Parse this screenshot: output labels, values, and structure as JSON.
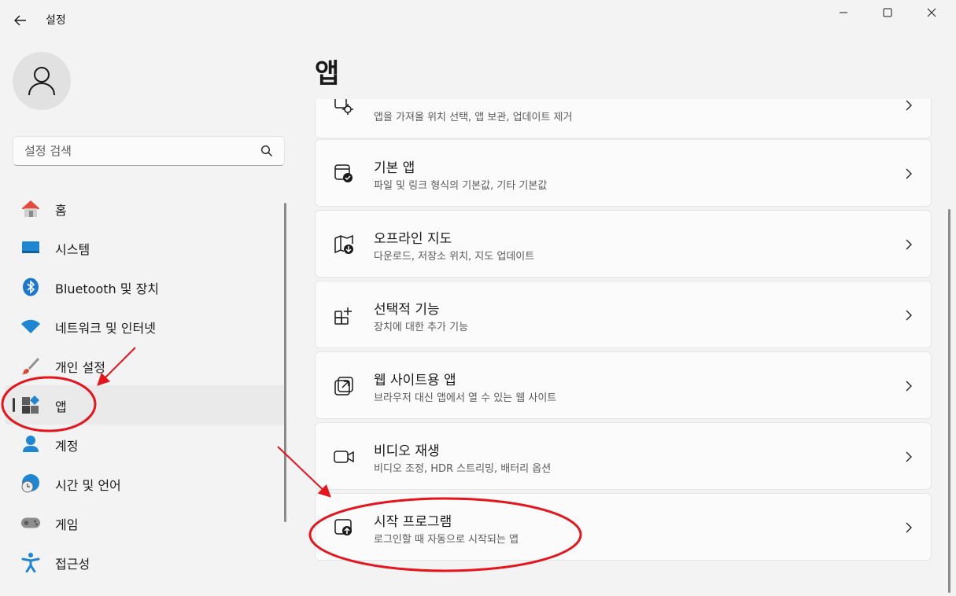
{
  "window": {
    "title": "설정",
    "controls": [
      "minimize-icon",
      "maximize-icon",
      "close-icon"
    ]
  },
  "search": {
    "placeholder": "설정 검색",
    "value": ""
  },
  "sidebar": {
    "items": [
      {
        "label": "홈",
        "icon": "home-icon",
        "selected": false
      },
      {
        "label": "시스템",
        "icon": "system-icon",
        "selected": false
      },
      {
        "label": "Bluetooth 및 장치",
        "icon": "bluetooth-icon",
        "selected": false
      },
      {
        "label": "네트워크 및 인터넷",
        "icon": "wifi-icon",
        "selected": false
      },
      {
        "label": "개인 설정",
        "icon": "brush-icon",
        "selected": false
      },
      {
        "label": "앱",
        "icon": "apps-icon",
        "selected": true
      },
      {
        "label": "계정",
        "icon": "account-icon",
        "selected": false
      },
      {
        "label": "시간 및 언어",
        "icon": "globe-clock-icon",
        "selected": false
      },
      {
        "label": "게임",
        "icon": "gamepad-icon",
        "selected": false
      },
      {
        "label": "접근성",
        "icon": "accessibility-icon",
        "selected": false
      }
    ]
  },
  "main": {
    "title": "앱",
    "cards": [
      {
        "title": "",
        "subtitle": "앱을 가져올 위치 선택, 앱 보관, 업데이트 제거",
        "icon": "app-gear-icon"
      },
      {
        "title": "기본 앱",
        "subtitle": "파일 및 링크 형식의 기본값, 기타 기본값",
        "icon": "default-apps-icon"
      },
      {
        "title": "오프라인 지도",
        "subtitle": "다운로드, 저장소 위치, 지도 업데이트",
        "icon": "offline-map-icon"
      },
      {
        "title": "선택적 기능",
        "subtitle": "장치에 대한 추가 기능",
        "icon": "optional-features-icon"
      },
      {
        "title": "웹 사이트용 앱",
        "subtitle": "브라우저 대신 앱에서 열 수 있는 웹 사이트",
        "icon": "website-apps-icon"
      },
      {
        "title": "비디오 재생",
        "subtitle": "비디오 조정, HDR 스트리밍, 배터리 옵션",
        "icon": "video-icon"
      },
      {
        "title": "시작 프로그램",
        "subtitle": "로그인할 때 자동으로 시작되는 앱",
        "icon": "startup-icon"
      }
    ]
  },
  "colors": {
    "annotation": "#e8141b",
    "accent": "#0067c0",
    "background": "#f3f3f3"
  }
}
